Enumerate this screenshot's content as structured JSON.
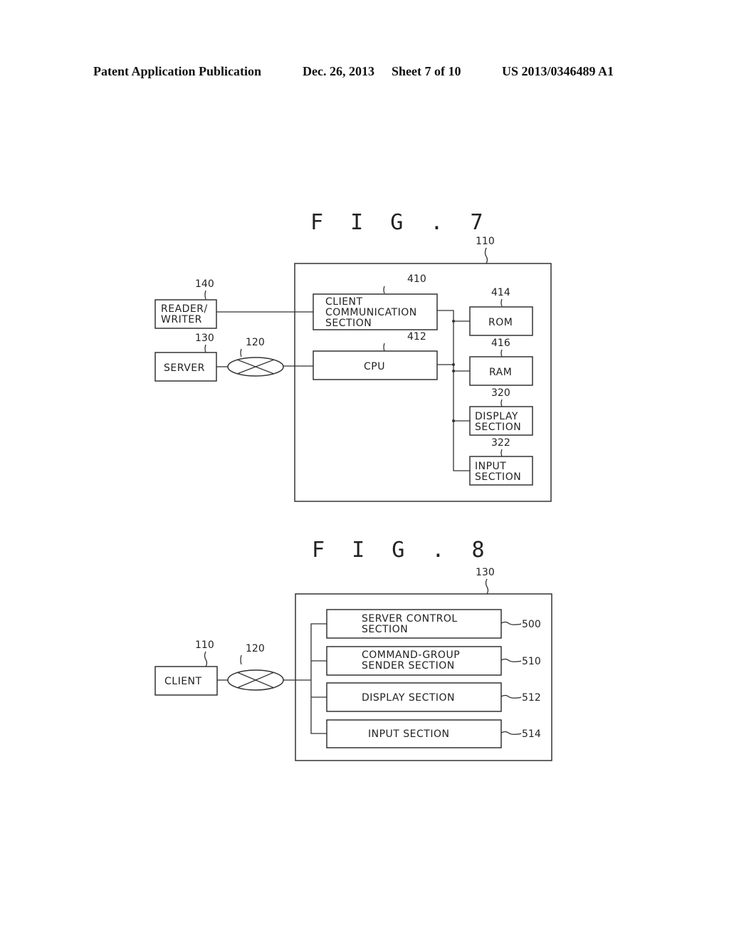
{
  "header": {
    "publication": "Patent Application Publication",
    "date": "Dec. 26, 2013",
    "sheet": "Sheet 7 of 10",
    "number": "US 2013/0346489 A1"
  },
  "fig7": {
    "title": "F I G . 7",
    "client_ref": "110",
    "reader_writer": {
      "ref": "140",
      "line1": "READER/",
      "line2": "WRITER"
    },
    "server": {
      "ref": "130",
      "label": "SERVER"
    },
    "network": {
      "ref": "120"
    },
    "client_comm": {
      "ref": "410",
      "line1": "CLIENT",
      "line2": "COMMUNICATION",
      "line3": "SECTION"
    },
    "cpu": {
      "ref": "412",
      "label": "CPU"
    },
    "rom": {
      "ref": "414",
      "label": "ROM"
    },
    "ram": {
      "ref": "416",
      "label": "RAM"
    },
    "display": {
      "ref": "320",
      "line1": "DISPLAY",
      "line2": "SECTION"
    },
    "input": {
      "ref": "322",
      "line1": "INPUT",
      "line2": "SECTION"
    }
  },
  "fig8": {
    "title": "F I G . 8",
    "server_ref": "130",
    "client": {
      "ref": "110",
      "label": "CLIENT"
    },
    "network": {
      "ref": "120"
    },
    "server_control": {
      "ref": "500",
      "line1": "SERVER CONTROL",
      "line2": "SECTION"
    },
    "command_group": {
      "ref": "510",
      "line1": "COMMAND-GROUP",
      "line2": "SENDER SECTION"
    },
    "display": {
      "ref": "512",
      "label": "DISPLAY SECTION"
    },
    "input": {
      "ref": "514",
      "label": "INPUT SECTION"
    }
  }
}
